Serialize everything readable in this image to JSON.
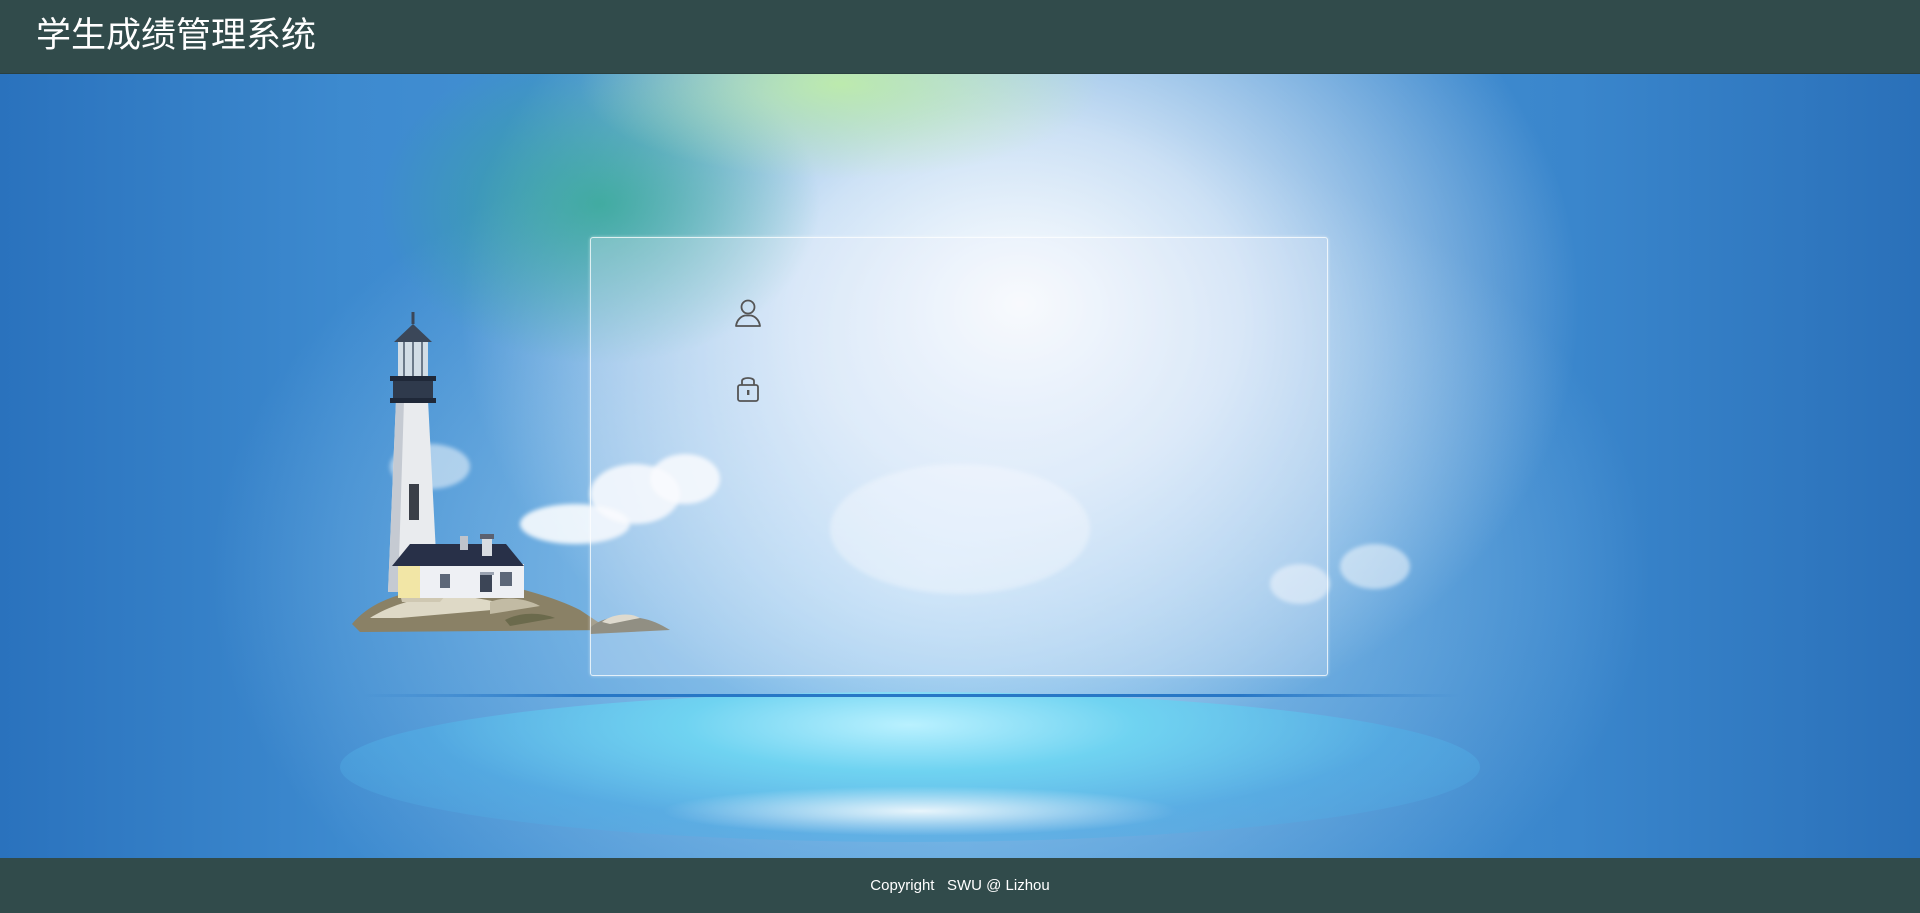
{
  "app": {
    "title": "学生成绩管理系统"
  },
  "login": {
    "username": {
      "icon": "user-icon",
      "value": "",
      "placeholder": ""
    },
    "password": {
      "icon": "lock-icon",
      "value": "",
      "placeholder": ""
    }
  },
  "footer": {
    "copyright": "Copyright   SWU @ Lizhou"
  },
  "colors": {
    "header_bg": "#314b4b",
    "footer_bg": "#314b4b",
    "sky_blue": "#3a86cc",
    "panel_border": "#ffffff",
    "icon_color": "#555555"
  }
}
